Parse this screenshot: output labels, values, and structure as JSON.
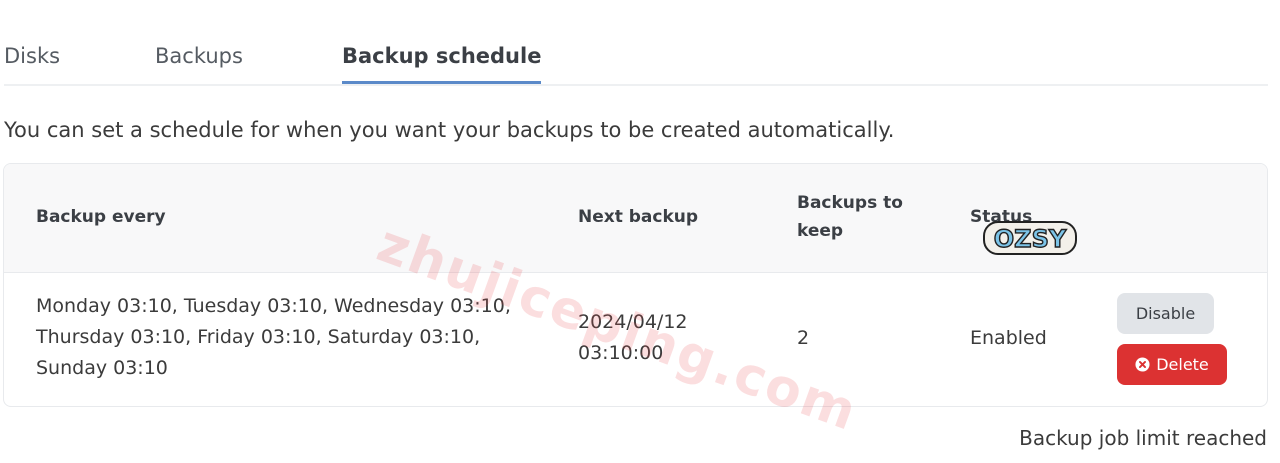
{
  "tabs": [
    {
      "label": "Disks",
      "active": false
    },
    {
      "label": "Backups",
      "active": false
    },
    {
      "label": "Backup schedule",
      "active": true
    }
  ],
  "intro": "You can set a schedule for when you want your backups to be created automatically.",
  "table": {
    "headers": {
      "every": "Backup every",
      "next": "Next backup",
      "keep": "Backups to keep",
      "status": "Status"
    },
    "rows": [
      {
        "every": "Monday 03:10, Tuesday 03:10, Wednesday 03:10, Thursday 03:10, Friday 03:10, Saturday 03:10, Sunday 03:10",
        "next": "2024/04/12 03:10:00",
        "keep": "2",
        "status": "Enabled",
        "disable_label": "Disable",
        "delete_label": "Delete"
      }
    ]
  },
  "limit_note": "Backup job limit reached",
  "watermark": {
    "site": "zhujiceping.com",
    "logo": "OZSY"
  },
  "colors": {
    "tab_underline": "#5b8ac9",
    "delete_button": "#dc3232",
    "disable_button": "#e1e4e8"
  }
}
